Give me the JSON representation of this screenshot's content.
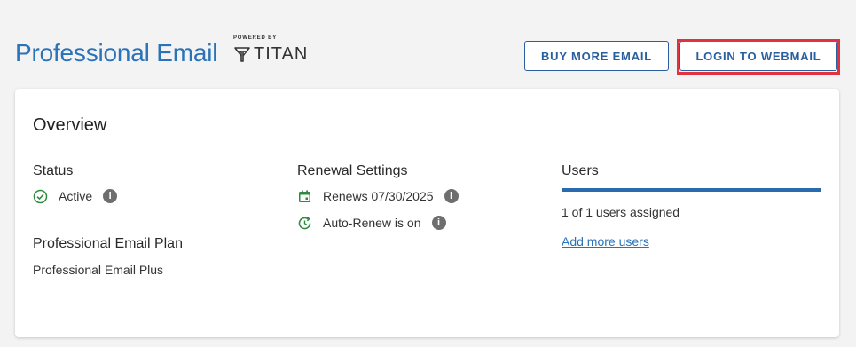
{
  "header": {
    "title": "Professional Email",
    "powered_by": "POWERED BY",
    "brand": "TITAN",
    "buy_button": "BUY MORE EMAIL",
    "login_button": "LOGIN TO WEBMAIL"
  },
  "overview": {
    "title": "Overview",
    "status": {
      "label": "Status",
      "value": "Active",
      "icon": "check-circle-icon"
    },
    "plan": {
      "label": "Professional Email Plan",
      "value": "Professional Email Plus"
    },
    "renewal": {
      "label": "Renewal Settings",
      "renews": "Renews 07/30/2025",
      "auto_renew": "Auto-Renew is on"
    },
    "users": {
      "label": "Users",
      "assigned": "1 of 1 users assigned",
      "add_link": "Add more users",
      "usage_fraction": 1.0
    }
  },
  "colors": {
    "title_blue": "#2a73b8",
    "button_blue": "#2a5f9e",
    "success_green": "#2e8b3d",
    "highlight_red": "#e0323f",
    "bar_blue": "#2a6bb0"
  }
}
